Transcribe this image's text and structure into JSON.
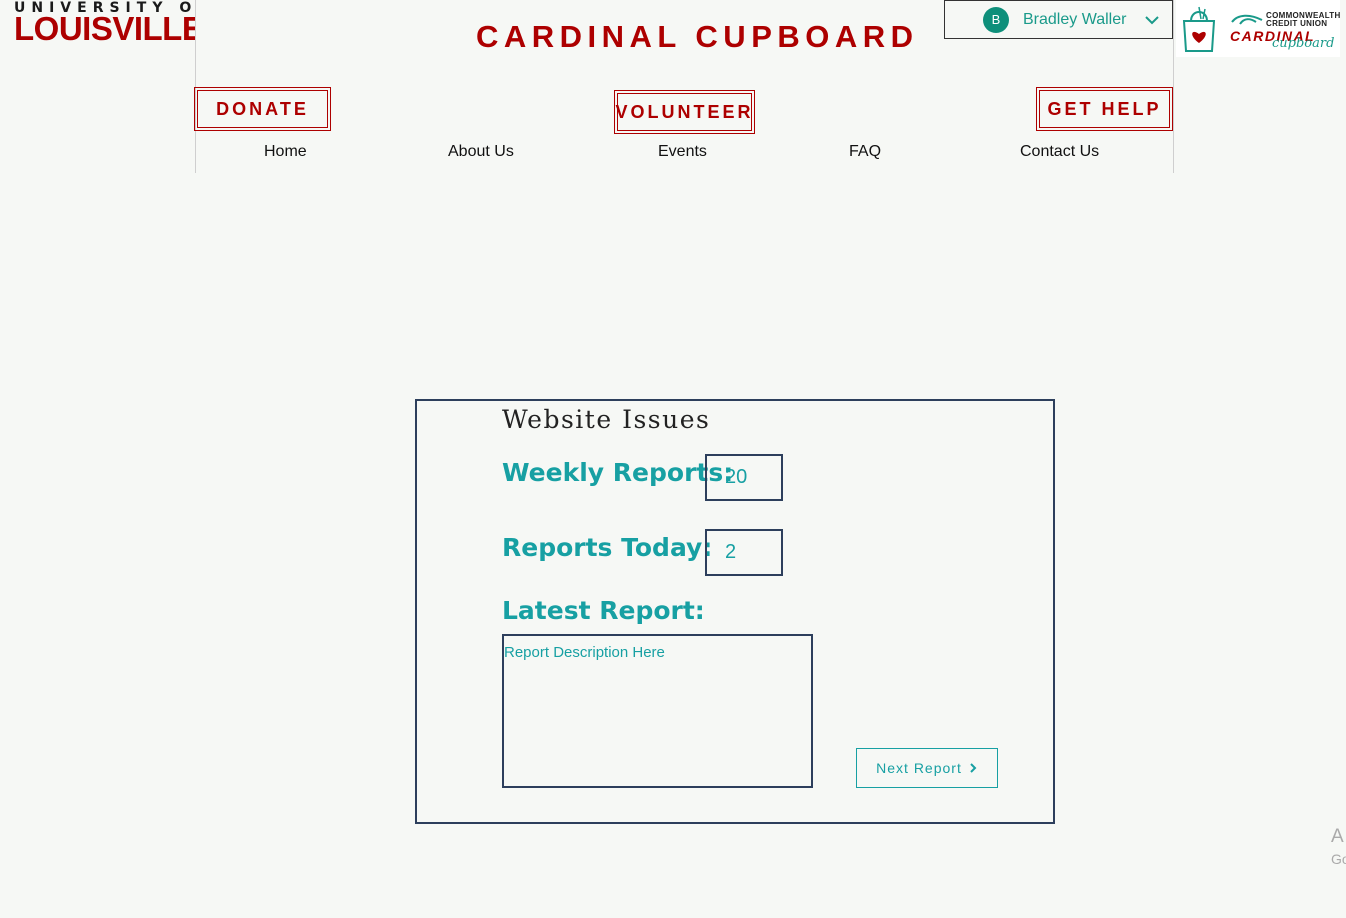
{
  "brand": {
    "university_top": "UNIVERSITY OF",
    "university_main": "LOUISVILLE",
    "site_title": "CARDINAL CUPBOARD",
    "logo": {
      "commonwealth": "COMMONWEALTH",
      "credit_union": "CREDIT UNION",
      "cardinal": "CARDINAL",
      "cupboard": "cupboard"
    }
  },
  "user": {
    "avatar_initial": "B",
    "name": "Bradley Waller"
  },
  "header_buttons": {
    "donate": "DONATE",
    "volunteer": "VOLUNTEER",
    "get_help": "GET HELP"
  },
  "nav": {
    "items": [
      "Home",
      "About Us",
      "Events",
      "FAQ",
      "Contact Us"
    ]
  },
  "issues": {
    "title": "Website Issues",
    "weekly_label": "Weekly Reports:",
    "weekly_value": "20",
    "today_label": "Reports Today:",
    "today_value": "2",
    "latest_label": "Latest Report:",
    "report_description": "Report Description Here",
    "next_button": "Next Report"
  },
  "corner": {
    "line1": "A",
    "line2": "Go"
  },
  "colors": {
    "brand_red": "#ad0000",
    "accent_teal": "#17a0a3",
    "border_navy": "#2d3f5c",
    "background": "#f6f8f5"
  }
}
